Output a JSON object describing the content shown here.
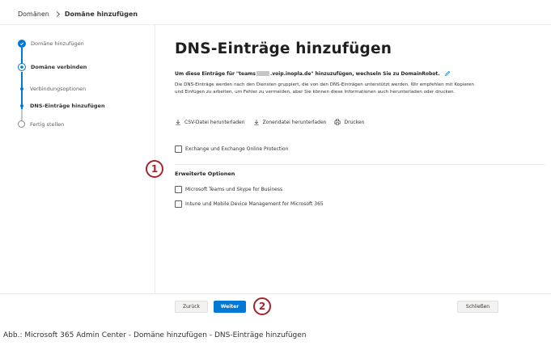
{
  "breadcrumb": {
    "parent": "Domänen",
    "current": "Domäne hinzufügen"
  },
  "stepper": {
    "steps": [
      {
        "label": "Domäne hinzufügen",
        "state": "done"
      },
      {
        "label": "Domäne verbinden",
        "state": "active"
      },
      {
        "label": "Verbindungsoptionen",
        "state": "substep"
      },
      {
        "label": "DNS-Einträge hinzufügen",
        "state": "substep-current"
      },
      {
        "label": "Fertig stellen",
        "state": "pending"
      }
    ]
  },
  "main": {
    "title": "DNS-Einträge hinzufügen",
    "subtitle_prefix": "Um diese Einträge für \"teams",
    "subtitle_suffix": ".voip.inopla.de\" hinzuzufügen, wechseln Sie zu DomainRobot.",
    "description": "Die DNS-Einträge werden nach den Diensten gruppiert, die von den DNS-Einträgen unterstützt werden. Wir empfehlen mit Kopieren und Einfügen zu arbeiten, um Fehler zu vermeiden, aber Sie können diese Informationen auch herunterladen oder drucken.",
    "actions": {
      "csv": "CSV-Datei herunterladen",
      "zone": "Zonendatei herunterladen",
      "print": "Drucken"
    },
    "exchange_option": "Exchange und Exchange Online Protection",
    "advanced_heading": "Erweiterte Optionen",
    "advanced_options": [
      "Microsoft Teams und Skype for Business",
      "Intune und Mobile Device Management for Microsoft 365"
    ]
  },
  "callouts": {
    "one": "1",
    "two": "2"
  },
  "footer": {
    "back": "Zurück",
    "next": "Weiter",
    "close": "Schließen"
  },
  "caption": "Abb.: Microsoft 365 Admin Center - Domäne hinzufügen - DNS-Einträge hinzufügen",
  "colors": {
    "accent": "#0078d4",
    "callout": "#a4262c"
  }
}
